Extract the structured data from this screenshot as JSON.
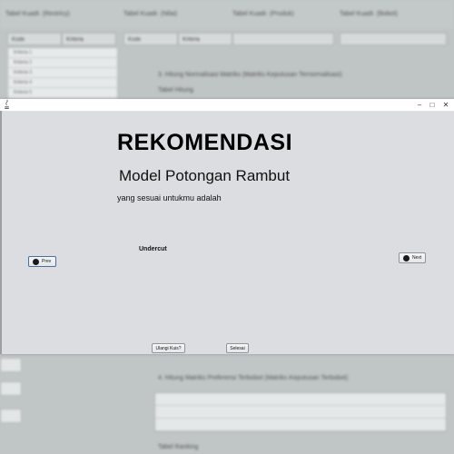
{
  "background_app": {
    "column_headers": [
      "Tabel Kuadr. (Restricy)",
      "Tabel Kuadr. (Nilai)",
      "Tabel Kuadr. (Produk)",
      "Tabel Kuadr. (Bobot)"
    ],
    "table_headers": [
      "Kode",
      "Kriteria",
      "Kode",
      "Kriteria"
    ],
    "left_rows": [
      "Kriteria 1",
      "Kriteria 2",
      "Kriteria 3",
      "Kriteria 4",
      "Kriteria 5"
    ],
    "section_1": "3. Hitung Normalisasi Matriks (Matriks Keputusan Ternormalisasi)",
    "section_1_sub": "Tabel Hitung",
    "section_2": "4. Hitung Matriks Preferensi Terbobot (Matriks Keputusan Terbobot)",
    "footer_text": "Tabel Ranking"
  },
  "dialog": {
    "title": "REKOMENDASI",
    "subtitle": "Model Potongan Rambut",
    "description": "yang sesuai untukmu adalah",
    "result": "Undercut",
    "prev_label": "Prev",
    "next_label": "Next",
    "retry_label": "Ulangi Kuis?",
    "done_label": "Selesai"
  },
  "window": {
    "minimize": "–",
    "maximize": "□",
    "close": "✕"
  }
}
